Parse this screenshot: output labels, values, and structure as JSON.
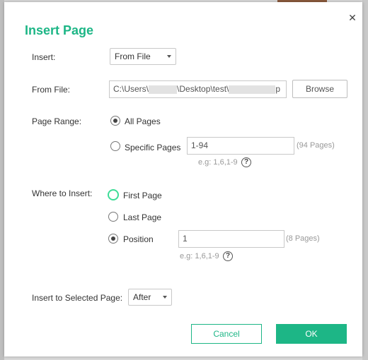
{
  "dialog": {
    "title": "Insert Page",
    "close_icon": "close-icon"
  },
  "insert": {
    "label": "Insert:",
    "selected": "From File"
  },
  "from_file": {
    "label": "From File:",
    "path_prefix": "C:\\Users\\",
    "path_middle": "\\Desktop\\test\\",
    "path_suffix": "p",
    "browse_label": "Browse"
  },
  "page_range": {
    "label": "Page Range:",
    "all_pages": "All Pages",
    "specific_pages": "Specific Pages",
    "specific_value": "1-94",
    "specific_count": "(94 Pages)",
    "example": "e.g: 1,6,1-9",
    "selected": "All Pages"
  },
  "where_to_insert": {
    "label": "Where to Insert:",
    "first_page": "First Page",
    "last_page": "Last Page",
    "position": "Position",
    "position_value": "1",
    "position_count": "(8 Pages)",
    "example": "e.g: 1,6,1-9",
    "selected": "Position"
  },
  "selected_page": {
    "label": "Insert to Selected Page:",
    "selected": "After"
  },
  "buttons": {
    "cancel": "Cancel",
    "ok": "OK"
  },
  "colors": {
    "accent": "#1db686",
    "focus_ring": "#3ddc97"
  }
}
